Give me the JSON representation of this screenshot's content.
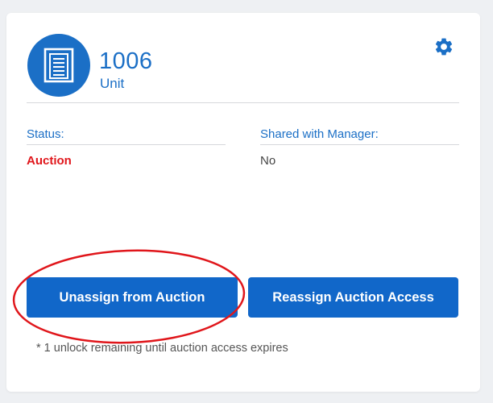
{
  "unit": {
    "number": "1006",
    "type_label": "Unit",
    "icon": "storage-unit-door-icon"
  },
  "settings": {
    "icon": "gear-icon"
  },
  "fields": {
    "status": {
      "label": "Status:",
      "value": "Auction",
      "value_color": "#e0161b"
    },
    "shared": {
      "label": "Shared with Manager:",
      "value": "No"
    }
  },
  "actions": {
    "unassign_label": "Unassign from Auction",
    "reassign_label": "Reassign Auction Access"
  },
  "footnote": "* 1 unlock remaining until auction access expires",
  "colors": {
    "brand_blue": "#1b6fc6",
    "button_blue": "#1167c9",
    "status_red": "#e0161b",
    "annotation_red": "#e0161b"
  }
}
